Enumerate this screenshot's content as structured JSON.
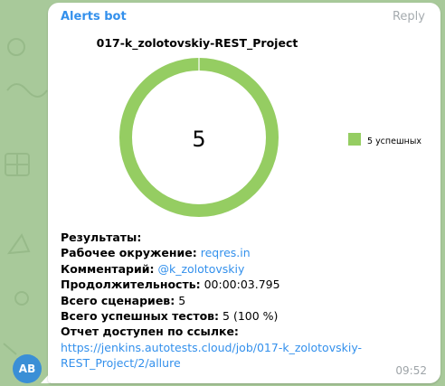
{
  "chat": {
    "sender": "Alerts bot",
    "reply_label": "Reply",
    "avatar_initials": "AB",
    "time": "09:52"
  },
  "chart_data": {
    "type": "pie",
    "title": "017-k_zolotovskiy-REST_Project",
    "center_label": "5",
    "series": [
      {
        "name": "5 успешных",
        "value": 5,
        "color": "#95cd62"
      }
    ],
    "legend_position": "right"
  },
  "report": {
    "results_label": "Результаты:",
    "environment_label": "Рабочее окружение:",
    "environment_value": "reqres.in",
    "comment_label": "Комментарий:",
    "comment_value": "@k_zolotovskiy",
    "duration_label": "Продолжительность:",
    "duration_value": "00:00:03.795",
    "scenarios_label": "Всего сценариев:",
    "scenarios_value": "5",
    "passed_label": "Всего успешных тестов:",
    "passed_value": "5 (100 %)",
    "link_label": "Отчет доступен по ссылке:",
    "link_line1": "https://jenkins.autotests.cloud/job/017-k_zolotovskiy-",
    "link_line2": "REST_Project/2/allure"
  },
  "colors": {
    "wallpaper": "#a8c99a",
    "accent": "#3390ec",
    "success": "#95cd62"
  }
}
